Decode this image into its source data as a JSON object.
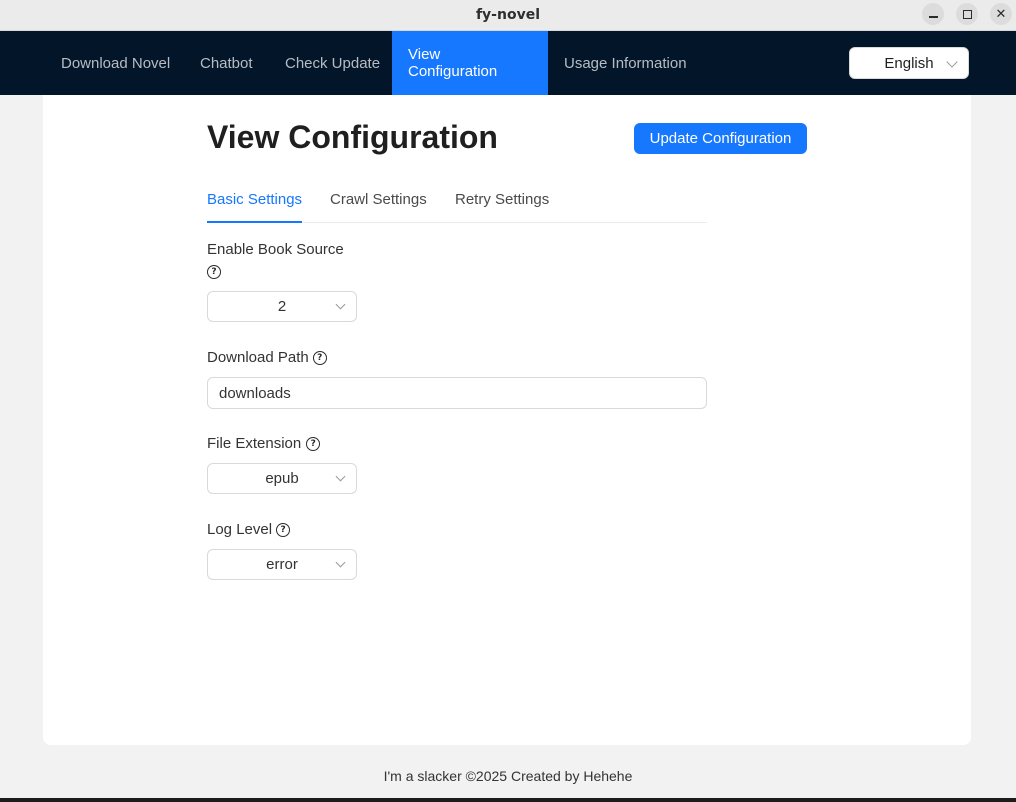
{
  "window": {
    "title": "fy-novel",
    "controls": [
      "minimize-icon",
      "maximize-icon",
      "close-icon"
    ]
  },
  "nav": {
    "items": [
      {
        "label": "Download Novel"
      },
      {
        "label": "Chatbot"
      },
      {
        "label": "Check Update"
      },
      {
        "label": "View Configuration",
        "active": true
      },
      {
        "label": "Usage Information"
      }
    ],
    "language": "English"
  },
  "page": {
    "title": "View Configuration",
    "update_button": "Update Configuration",
    "tabs": [
      {
        "label": "Basic Settings",
        "active": true
      },
      {
        "label": "Crawl Settings"
      },
      {
        "label": "Retry Settings"
      }
    ],
    "fields": {
      "book_source": {
        "label": "Enable Book Source",
        "value": "2",
        "help_icon": "question-circle-icon"
      },
      "download_path": {
        "label": "Download Path",
        "value": "downloads",
        "help_icon": "question-circle-icon"
      },
      "file_extension": {
        "label": "File Extension",
        "value": "epub",
        "help_icon": "question-circle-icon"
      },
      "log_level": {
        "label": "Log Level",
        "value": "error",
        "help_icon": "question-circle-icon"
      }
    }
  },
  "footer": {
    "text": "I'm a slacker ©2025 Created by Hehehe"
  },
  "colors": {
    "nav_bg": "#031529",
    "accent": "#1677ff",
    "page_bg": "#f2f2f2"
  }
}
